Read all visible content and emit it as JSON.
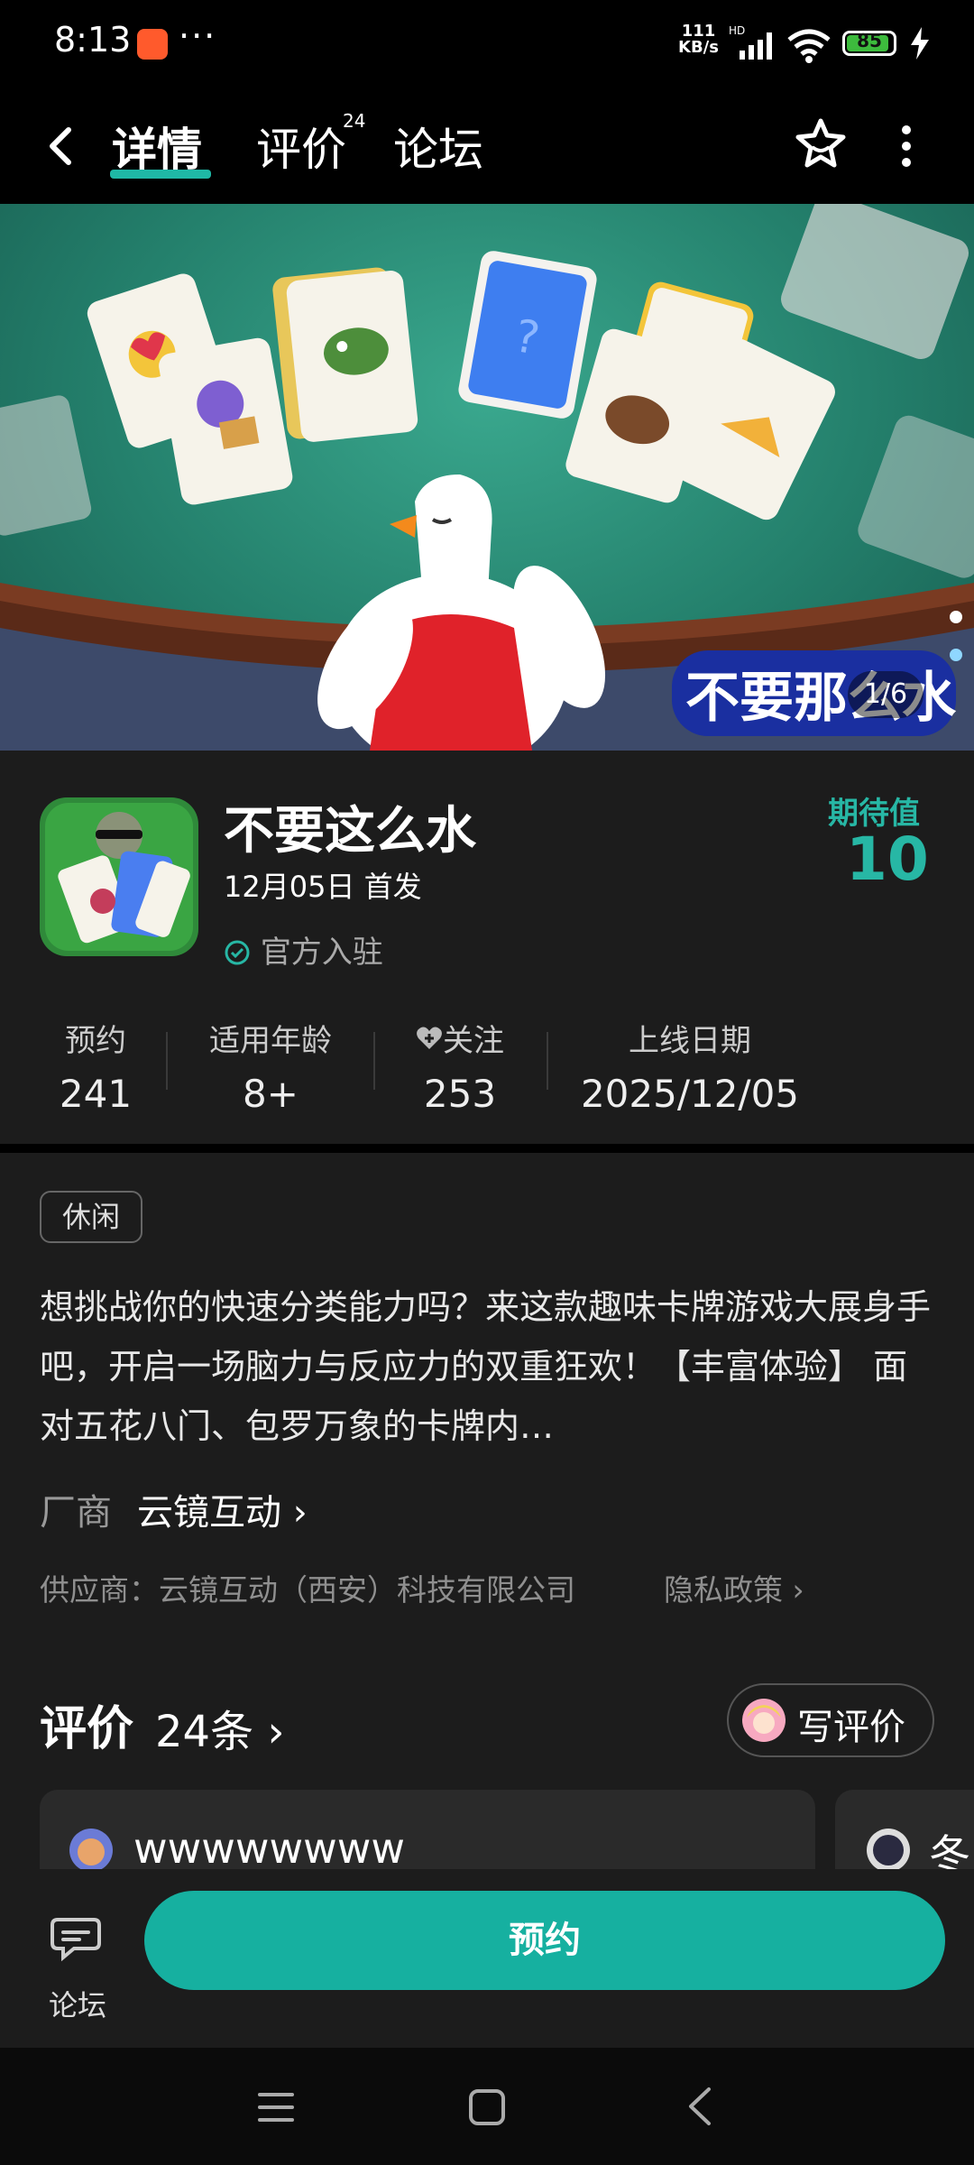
{
  "status_bar": {
    "time": "8:13",
    "net_speed": "111",
    "net_unit": "KB/s",
    "network_type": "HD",
    "battery": "85",
    "battery_level": 0.85
  },
  "nav": {
    "tabs": [
      {
        "label": "详情",
        "active": true
      },
      {
        "label": "评价",
        "badge": "24"
      },
      {
        "label": "论坛"
      }
    ],
    "icons": [
      "back-arrow-icon",
      "favorite-star-icon",
      "more-vertical-icon"
    ]
  },
  "banner": {
    "counter": "1/6",
    "logo_text": "不要那么水"
  },
  "game": {
    "title": "不要这么水",
    "release_line": "12月05日 首发",
    "official": "官方入驻",
    "expect_label": "期待值",
    "expect_value": "10"
  },
  "stats": [
    {
      "label": "预约",
      "value": "241"
    },
    {
      "label": "适用年龄",
      "value": "8+"
    },
    {
      "label": "关注",
      "value": "253"
    },
    {
      "label": "上线日期",
      "value": "2025/12/05"
    }
  ],
  "details": {
    "tag": "休闲",
    "description": "想挑战你的快速分类能力吗？来这款趣味卡牌游戏大展身手吧，开启一场脑力与反应力的双重狂欢！【丰富体验】 面对五花八门、包罗万象的卡牌内…",
    "vendor_label": "厂商",
    "vendor_name": "云镜互动 ›",
    "supplier": "供应商：云镜互动（西安）科技有限公司",
    "privacy": "隐私政策 ›"
  },
  "reviews": {
    "title": "评价",
    "count": "24条 ›",
    "write_button": "写评价",
    "items": [
      {
        "user": "wwwwwwww"
      },
      {
        "user": "冬"
      }
    ]
  },
  "bottom": {
    "forum_label": "论坛",
    "reserve_button": "预约"
  },
  "colors": {
    "accent": "#16b0a0",
    "background": "#1c1c1c"
  }
}
